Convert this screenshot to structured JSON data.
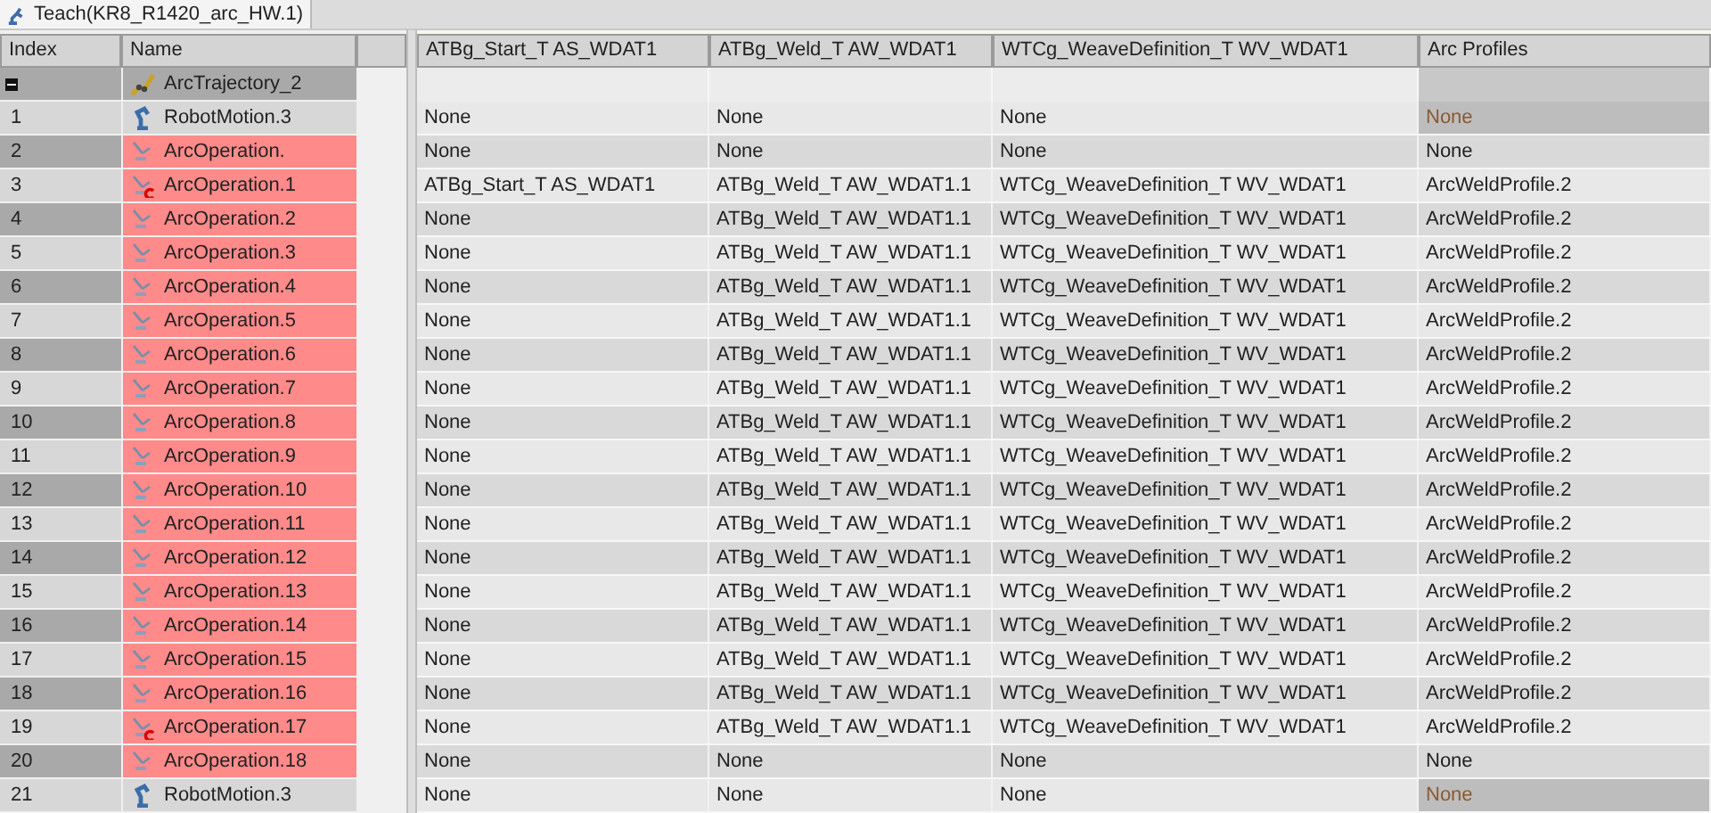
{
  "tab": {
    "title": "Teach(KR8_R1420_arc_HW.1)"
  },
  "left_columns": [
    "Index",
    "Name"
  ],
  "right_columns": [
    "ATBg_Start_T AS_WDAT1",
    "ATBg_Weld_T AW_WDAT1",
    "WTCg_WeaveDefinition_T WV_WDAT1",
    "Arc Profiles"
  ],
  "trajectory": {
    "name": "ArcTrajectory_2",
    "expanded": true
  },
  "rows": [
    {
      "index": "1",
      "name": "RobotMotion.3",
      "kind": "motion",
      "flagged": false,
      "cells": [
        "None",
        "None",
        "None",
        "None"
      ]
    },
    {
      "index": "2",
      "name": "ArcOperation.",
      "kind": "operation",
      "flagged": false,
      "cells": [
        "None",
        "None",
        "None",
        "None"
      ]
    },
    {
      "index": "3",
      "name": "ArcOperation.1",
      "kind": "operation",
      "flagged": true,
      "cells": [
        "ATBg_Start_T AS_WDAT1",
        "ATBg_Weld_T AW_WDAT1.1",
        "WTCg_WeaveDefinition_T WV_WDAT1",
        "ArcWeldProfile.2"
      ]
    },
    {
      "index": "4",
      "name": "ArcOperation.2",
      "kind": "operation",
      "flagged": false,
      "cells": [
        "None",
        "ATBg_Weld_T AW_WDAT1.1",
        "WTCg_WeaveDefinition_T WV_WDAT1",
        "ArcWeldProfile.2"
      ]
    },
    {
      "index": "5",
      "name": "ArcOperation.3",
      "kind": "operation",
      "flagged": false,
      "cells": [
        "None",
        "ATBg_Weld_T AW_WDAT1.1",
        "WTCg_WeaveDefinition_T WV_WDAT1",
        "ArcWeldProfile.2"
      ]
    },
    {
      "index": "6",
      "name": "ArcOperation.4",
      "kind": "operation",
      "flagged": false,
      "cells": [
        "None",
        "ATBg_Weld_T AW_WDAT1.1",
        "WTCg_WeaveDefinition_T WV_WDAT1",
        "ArcWeldProfile.2"
      ]
    },
    {
      "index": "7",
      "name": "ArcOperation.5",
      "kind": "operation",
      "flagged": false,
      "cells": [
        "None",
        "ATBg_Weld_T AW_WDAT1.1",
        "WTCg_WeaveDefinition_T WV_WDAT1",
        "ArcWeldProfile.2"
      ]
    },
    {
      "index": "8",
      "name": "ArcOperation.6",
      "kind": "operation",
      "flagged": false,
      "cells": [
        "None",
        "ATBg_Weld_T AW_WDAT1.1",
        "WTCg_WeaveDefinition_T WV_WDAT1",
        "ArcWeldProfile.2"
      ]
    },
    {
      "index": "9",
      "name": "ArcOperation.7",
      "kind": "operation",
      "flagged": false,
      "cells": [
        "None",
        "ATBg_Weld_T AW_WDAT1.1",
        "WTCg_WeaveDefinition_T WV_WDAT1",
        "ArcWeldProfile.2"
      ]
    },
    {
      "index": "10",
      "name": "ArcOperation.8",
      "kind": "operation",
      "flagged": false,
      "cells": [
        "None",
        "ATBg_Weld_T AW_WDAT1.1",
        "WTCg_WeaveDefinition_T WV_WDAT1",
        "ArcWeldProfile.2"
      ]
    },
    {
      "index": "11",
      "name": "ArcOperation.9",
      "kind": "operation",
      "flagged": false,
      "cells": [
        "None",
        "ATBg_Weld_T AW_WDAT1.1",
        "WTCg_WeaveDefinition_T WV_WDAT1",
        "ArcWeldProfile.2"
      ]
    },
    {
      "index": "12",
      "name": "ArcOperation.10",
      "kind": "operation",
      "flagged": false,
      "cells": [
        "None",
        "ATBg_Weld_T AW_WDAT1.1",
        "WTCg_WeaveDefinition_T WV_WDAT1",
        "ArcWeldProfile.2"
      ]
    },
    {
      "index": "13",
      "name": "ArcOperation.11",
      "kind": "operation",
      "flagged": false,
      "cells": [
        "None",
        "ATBg_Weld_T AW_WDAT1.1",
        "WTCg_WeaveDefinition_T WV_WDAT1",
        "ArcWeldProfile.2"
      ]
    },
    {
      "index": "14",
      "name": "ArcOperation.12",
      "kind": "operation",
      "flagged": false,
      "cells": [
        "None",
        "ATBg_Weld_T AW_WDAT1.1",
        "WTCg_WeaveDefinition_T WV_WDAT1",
        "ArcWeldProfile.2"
      ]
    },
    {
      "index": "15",
      "name": "ArcOperation.13",
      "kind": "operation",
      "flagged": false,
      "cells": [
        "None",
        "ATBg_Weld_T AW_WDAT1.1",
        "WTCg_WeaveDefinition_T WV_WDAT1",
        "ArcWeldProfile.2"
      ]
    },
    {
      "index": "16",
      "name": "ArcOperation.14",
      "kind": "operation",
      "flagged": false,
      "cells": [
        "None",
        "ATBg_Weld_T AW_WDAT1.1",
        "WTCg_WeaveDefinition_T WV_WDAT1",
        "ArcWeldProfile.2"
      ]
    },
    {
      "index": "17",
      "name": "ArcOperation.15",
      "kind": "operation",
      "flagged": false,
      "cells": [
        "None",
        "ATBg_Weld_T AW_WDAT1.1",
        "WTCg_WeaveDefinition_T WV_WDAT1",
        "ArcWeldProfile.2"
      ]
    },
    {
      "index": "18",
      "name": "ArcOperation.16",
      "kind": "operation",
      "flagged": false,
      "cells": [
        "None",
        "ATBg_Weld_T AW_WDAT1.1",
        "WTCg_WeaveDefinition_T WV_WDAT1",
        "ArcWeldProfile.2"
      ]
    },
    {
      "index": "19",
      "name": "ArcOperation.17",
      "kind": "operation",
      "flagged": true,
      "cells": [
        "None",
        "ATBg_Weld_T AW_WDAT1.1",
        "WTCg_WeaveDefinition_T WV_WDAT1",
        "ArcWeldProfile.2"
      ]
    },
    {
      "index": "20",
      "name": "ArcOperation.18",
      "kind": "operation",
      "flagged": false,
      "cells": [
        "None",
        "None",
        "None",
        "None"
      ]
    },
    {
      "index": "21",
      "name": "RobotMotion.3",
      "kind": "motion",
      "flagged": false,
      "cells": [
        "None",
        "None",
        "None",
        "None"
      ]
    }
  ]
}
